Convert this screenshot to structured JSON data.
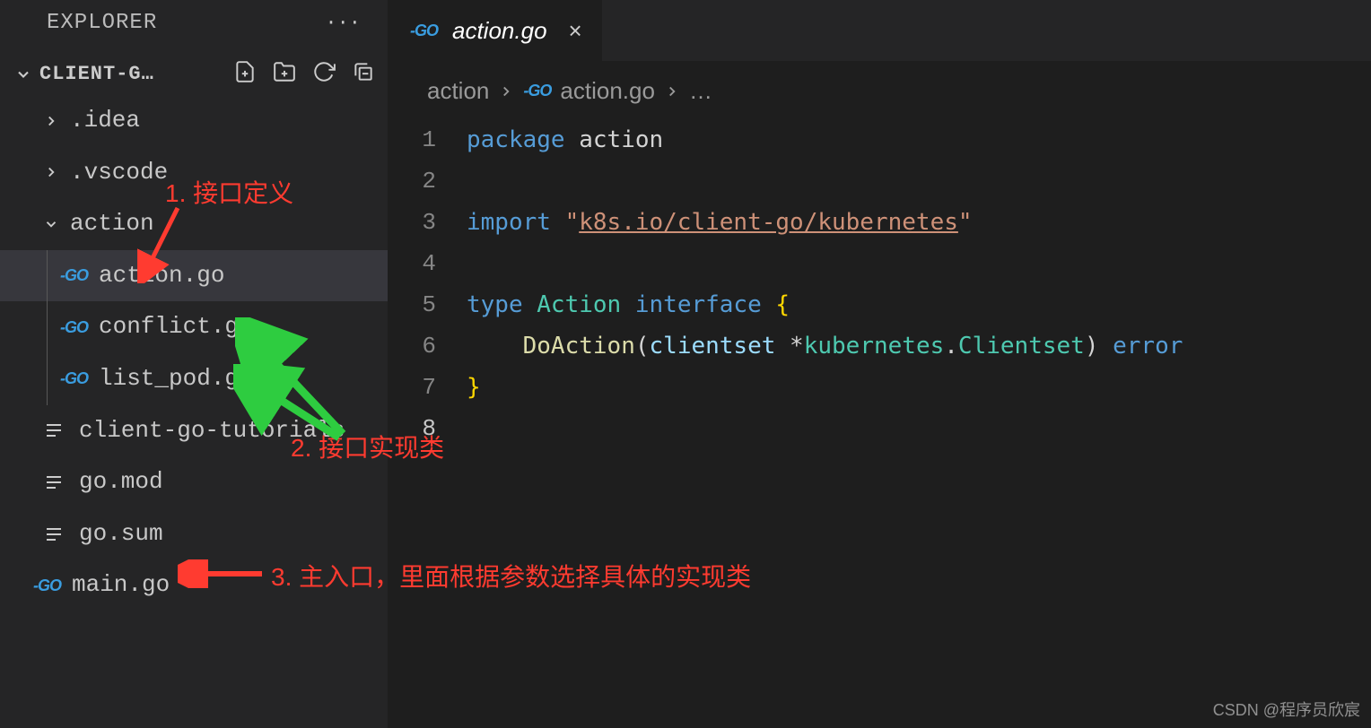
{
  "explorer": {
    "title": "EXPLORER"
  },
  "project": {
    "name": "CLIENT-G…"
  },
  "files": {
    "idea": ".idea",
    "vscode": ".vscode",
    "action": "action",
    "action_go": "action.go",
    "conflict_go": "conflict.go",
    "list_pod_go": "list_pod.go",
    "tutorials": "client-go-tutorials",
    "gomod": "go.mod",
    "gosum": "go.sum",
    "main_go": "main.go"
  },
  "tab": {
    "label": "action.go"
  },
  "breadcrumb": {
    "folder": "action",
    "file": "action.go",
    "more": "…"
  },
  "code": {
    "line_numbers": [
      "1",
      "2",
      "3",
      "4",
      "5",
      "6",
      "7",
      "8"
    ],
    "l1": {
      "kw": "package",
      "name": "action"
    },
    "l3": {
      "kw": "import",
      "q1": "\"",
      "str": "k8s.io/client-go/kubernetes",
      "q2": "\""
    },
    "l5": {
      "kw1": "type",
      "name": "Action",
      "kw2": "interface",
      "brace": "{"
    },
    "l6": {
      "fn": "DoAction",
      "lp": "(",
      "param": "clientset",
      "star": " *",
      "ns": "kubernetes",
      "dot": ".",
      "cls": "Clientset",
      "rp": ")",
      "ret": " error"
    },
    "l7": {
      "brace": "}"
    }
  },
  "annotations": {
    "a1": "1. 接口定义",
    "a2": "2. 接口实现类",
    "a3": "3. 主入口，里面根据参数选择具体的实现类"
  },
  "watermark": "CSDN @程序员欣宸"
}
